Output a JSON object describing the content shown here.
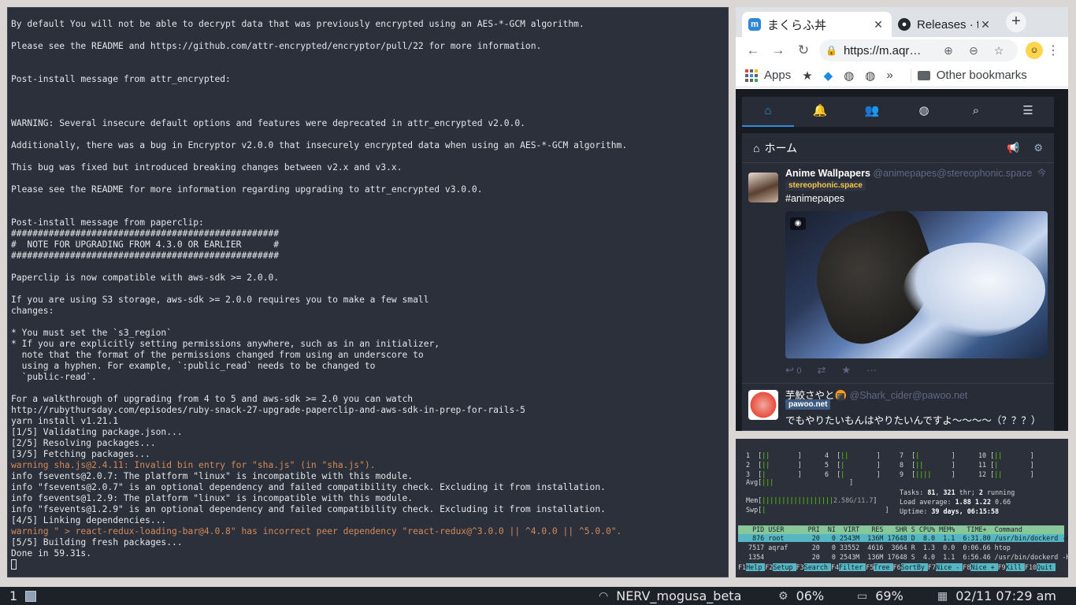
{
  "terminal": {
    "lines": [
      {
        "text": "By default You will not be able to decrypt data that was previously encrypted using an AES-*-GCM algorithm.",
        "color": "normal"
      },
      {
        "text": "",
        "color": "normal"
      },
      {
        "text": "Please see the README and https://github.com/attr-encrypted/encryptor/pull/22 for more information.",
        "color": "normal"
      },
      {
        "text": "",
        "color": "normal"
      },
      {
        "text": "",
        "color": "normal"
      },
      {
        "text": "Post-install message from attr_encrypted:",
        "color": "normal"
      },
      {
        "text": "",
        "color": "normal"
      },
      {
        "text": "",
        "color": "normal"
      },
      {
        "text": "",
        "color": "normal"
      },
      {
        "text": "WARNING: Several insecure default options and features were deprecated in attr_encrypted v2.0.0.",
        "color": "normal"
      },
      {
        "text": "",
        "color": "normal"
      },
      {
        "text": "Additionally, there was a bug in Encryptor v2.0.0 that insecurely encrypted data when using an AES-*-GCM algorithm.",
        "color": "normal"
      },
      {
        "text": "",
        "color": "normal"
      },
      {
        "text": "This bug was fixed but introduced breaking changes between v2.x and v3.x.",
        "color": "normal"
      },
      {
        "text": "",
        "color": "normal"
      },
      {
        "text": "Please see the README for more information regarding upgrading to attr_encrypted v3.0.0.",
        "color": "normal"
      },
      {
        "text": "",
        "color": "normal"
      },
      {
        "text": "",
        "color": "normal"
      },
      {
        "text": "Post-install message from paperclip:",
        "color": "normal"
      },
      {
        "text": "##################################################",
        "color": "normal"
      },
      {
        "text": "#  NOTE FOR UPGRADING FROM 4.3.0 OR EARLIER      #",
        "color": "normal"
      },
      {
        "text": "##################################################",
        "color": "normal"
      },
      {
        "text": "",
        "color": "normal"
      },
      {
        "text": "Paperclip is now compatible with aws-sdk >= 2.0.0.",
        "color": "normal"
      },
      {
        "text": "",
        "color": "normal"
      },
      {
        "text": "If you are using S3 storage, aws-sdk >= 2.0.0 requires you to make a few small",
        "color": "normal"
      },
      {
        "text": "changes:",
        "color": "normal"
      },
      {
        "text": "",
        "color": "normal"
      },
      {
        "text": "* You must set the `s3_region`",
        "color": "normal"
      },
      {
        "text": "* If you are explicitly setting permissions anywhere, such as in an initializer,",
        "color": "normal"
      },
      {
        "text": "  note that the format of the permissions changed from using an underscore to",
        "color": "normal"
      },
      {
        "text": "  using a hyphen. For example, `:public_read` needs to be changed to",
        "color": "normal"
      },
      {
        "text": "  `public-read`.",
        "color": "normal"
      },
      {
        "text": "",
        "color": "normal"
      },
      {
        "text": "For a walkthrough of upgrading from 4 to 5 and aws-sdk >= 2.0 you can watch",
        "color": "normal"
      },
      {
        "text": "http://rubythursday.com/episodes/ruby-snack-27-upgrade-paperclip-and-aws-sdk-in-prep-for-rails-5",
        "color": "normal"
      },
      {
        "text": "yarn install v1.21.1",
        "color": "normal"
      },
      {
        "text": "[1/5] Validating package.json...",
        "color": "normal"
      },
      {
        "text": "[2/5] Resolving packages...",
        "color": "normal"
      },
      {
        "text": "[3/5] Fetching packages...",
        "color": "normal"
      },
      {
        "text": "warning sha.js@2.4.11: Invalid bin entry for \"sha.js\" (in \"sha.js\").",
        "color": "warn"
      },
      {
        "text": "info fsevents@2.0.7: The platform \"linux\" is incompatible with this module.",
        "color": "normal"
      },
      {
        "text": "info \"fsevents@2.0.7\" is an optional dependency and failed compatibility check. Excluding it from installation.",
        "color": "normal"
      },
      {
        "text": "info fsevents@1.2.9: The platform \"linux\" is incompatible with this module.",
        "color": "normal"
      },
      {
        "text": "info \"fsevents@1.2.9\" is an optional dependency and failed compatibility check. Excluding it from installation.",
        "color": "normal"
      },
      {
        "text": "[4/5] Linking dependencies...",
        "color": "normal"
      },
      {
        "text": "warning \" > react-redux-loading-bar@4.0.8\" has incorrect peer dependency \"react-redux@^3.0.0 || ^4.0.0 || ^5.0.0\".",
        "color": "warn"
      },
      {
        "text": "[5/5] Building fresh packages...",
        "color": "normal"
      },
      {
        "text": "Done in 59.31s.",
        "color": "normal"
      }
    ],
    "colors": {
      "background": "#2b303b",
      "text": "#e3e6ea",
      "warning": "#d38a58"
    }
  },
  "browser": {
    "tabs": [
      {
        "title": "まくらふ丼",
        "active": true,
        "favicon": "mastodon-icon"
      },
      {
        "title": "Releases · too",
        "active": false,
        "favicon": "github-icon"
      }
    ],
    "new_tab_label": "+",
    "url": "https://m.aqr…",
    "bookmarks": {
      "apps_label": "Apps",
      "overflow_label": "»",
      "other_label": "Other bookmarks"
    },
    "mastodon": {
      "column_title": "ホーム",
      "statuses": [
        {
          "display_name": "Anime Wallpapers",
          "acct": "@animepapes@stereophonic.space",
          "instance": "stereophonic.space",
          "time": "今",
          "content": "#animepapes",
          "reply_count": "0"
        },
        {
          "display_name": "芋鮫さやと🍘",
          "acct": "@Shark_cider@pawoo.net",
          "instance": "pawoo.net",
          "content": "でもやりたいもんはやりたいんですよ〜〜〜〜（？？？）"
        }
      ],
      "colors": {
        "accent": "#2b90d9",
        "bg": "#191b22",
        "panel": "#282c37"
      }
    }
  },
  "htop": {
    "cpus": [
      {
        "num": "1",
        "bar": "||",
        "bar2": ""
      },
      {
        "num": "2",
        "bar": "||",
        "bar2": ""
      },
      {
        "num": "3",
        "bar": "|",
        "bar2": ""
      },
      {
        "num": "4",
        "bar": "||",
        "bar2": ""
      },
      {
        "num": "5",
        "bar": "|",
        "bar2": ""
      },
      {
        "num": "6",
        "bar": "|",
        "bar2": ""
      },
      {
        "num": "7",
        "bar": "|",
        "bar2": ""
      },
      {
        "num": "8",
        "bar": "||",
        "bar2": ""
      },
      {
        "num": "9",
        "bar": "||||",
        "bar2": ""
      },
      {
        "num": "10",
        "bar": "||",
        "bar2": ""
      },
      {
        "num": "11",
        "bar": "|",
        "bar2": ""
      },
      {
        "num": "12",
        "bar": "||",
        "bar2": ""
      }
    ],
    "avg_label": "Avg",
    "avg_bar": "|||",
    "mem_label": "Mem",
    "mem_value": "2.58G/11.7",
    "swp_label": "Swp",
    "tasks_label": "Tasks:",
    "tasks_count": "81",
    "thr_count": "321",
    "thr_label": "thr;",
    "running_count": "2",
    "running_label": "running",
    "load_label": "Load average:",
    "load1": "1.88",
    "load5": "1.22",
    "load15": "0.66",
    "uptime_label": "Uptime:",
    "uptime_value": "39 days, 06:15:58",
    "header": "  PID USER      PRI  NI  VIRT   RES   SHR S CPU% MEM%   TIME+  Command",
    "rows": [
      {
        "text": "  876 root       20   0 2543M  136M 17648 D  8.0  1.1  6:31.80 /usr/bin/dockerd -H",
        "selected": true
      },
      {
        "text": " 7517 aqraf      20   0 33552  4616  3664 R  1.3  0.0  0:06.66 htop",
        "selected": false
      },
      {
        "text": " 1354            20   0 2543M  136M 17648 S  4.0  1.1  6:56.46 /usr/bin/dockerd -H",
        "selected": false
      }
    ],
    "fkeys": [
      {
        "key": "F1",
        "label": "Help"
      },
      {
        "key": "F2",
        "label": "Setup"
      },
      {
        "key": "F3",
        "label": "Search"
      },
      {
        "key": "F4",
        "label": "Filter"
      },
      {
        "key": "F5",
        "label": "Tree"
      },
      {
        "key": "F6",
        "label": "SortBy"
      },
      {
        "key": "F7",
        "label": "Nice -"
      },
      {
        "key": "F8",
        "label": "Nice +"
      },
      {
        "key": "F9",
        "label": "Kill"
      },
      {
        "key": "F10",
        "label": "Quit"
      }
    ]
  },
  "statusbar": {
    "workspace": "1",
    "wifi": "NERV_mogusa_beta",
    "cpu": "06%",
    "battery": "69%",
    "datetime": "02/11 07:29 am"
  }
}
